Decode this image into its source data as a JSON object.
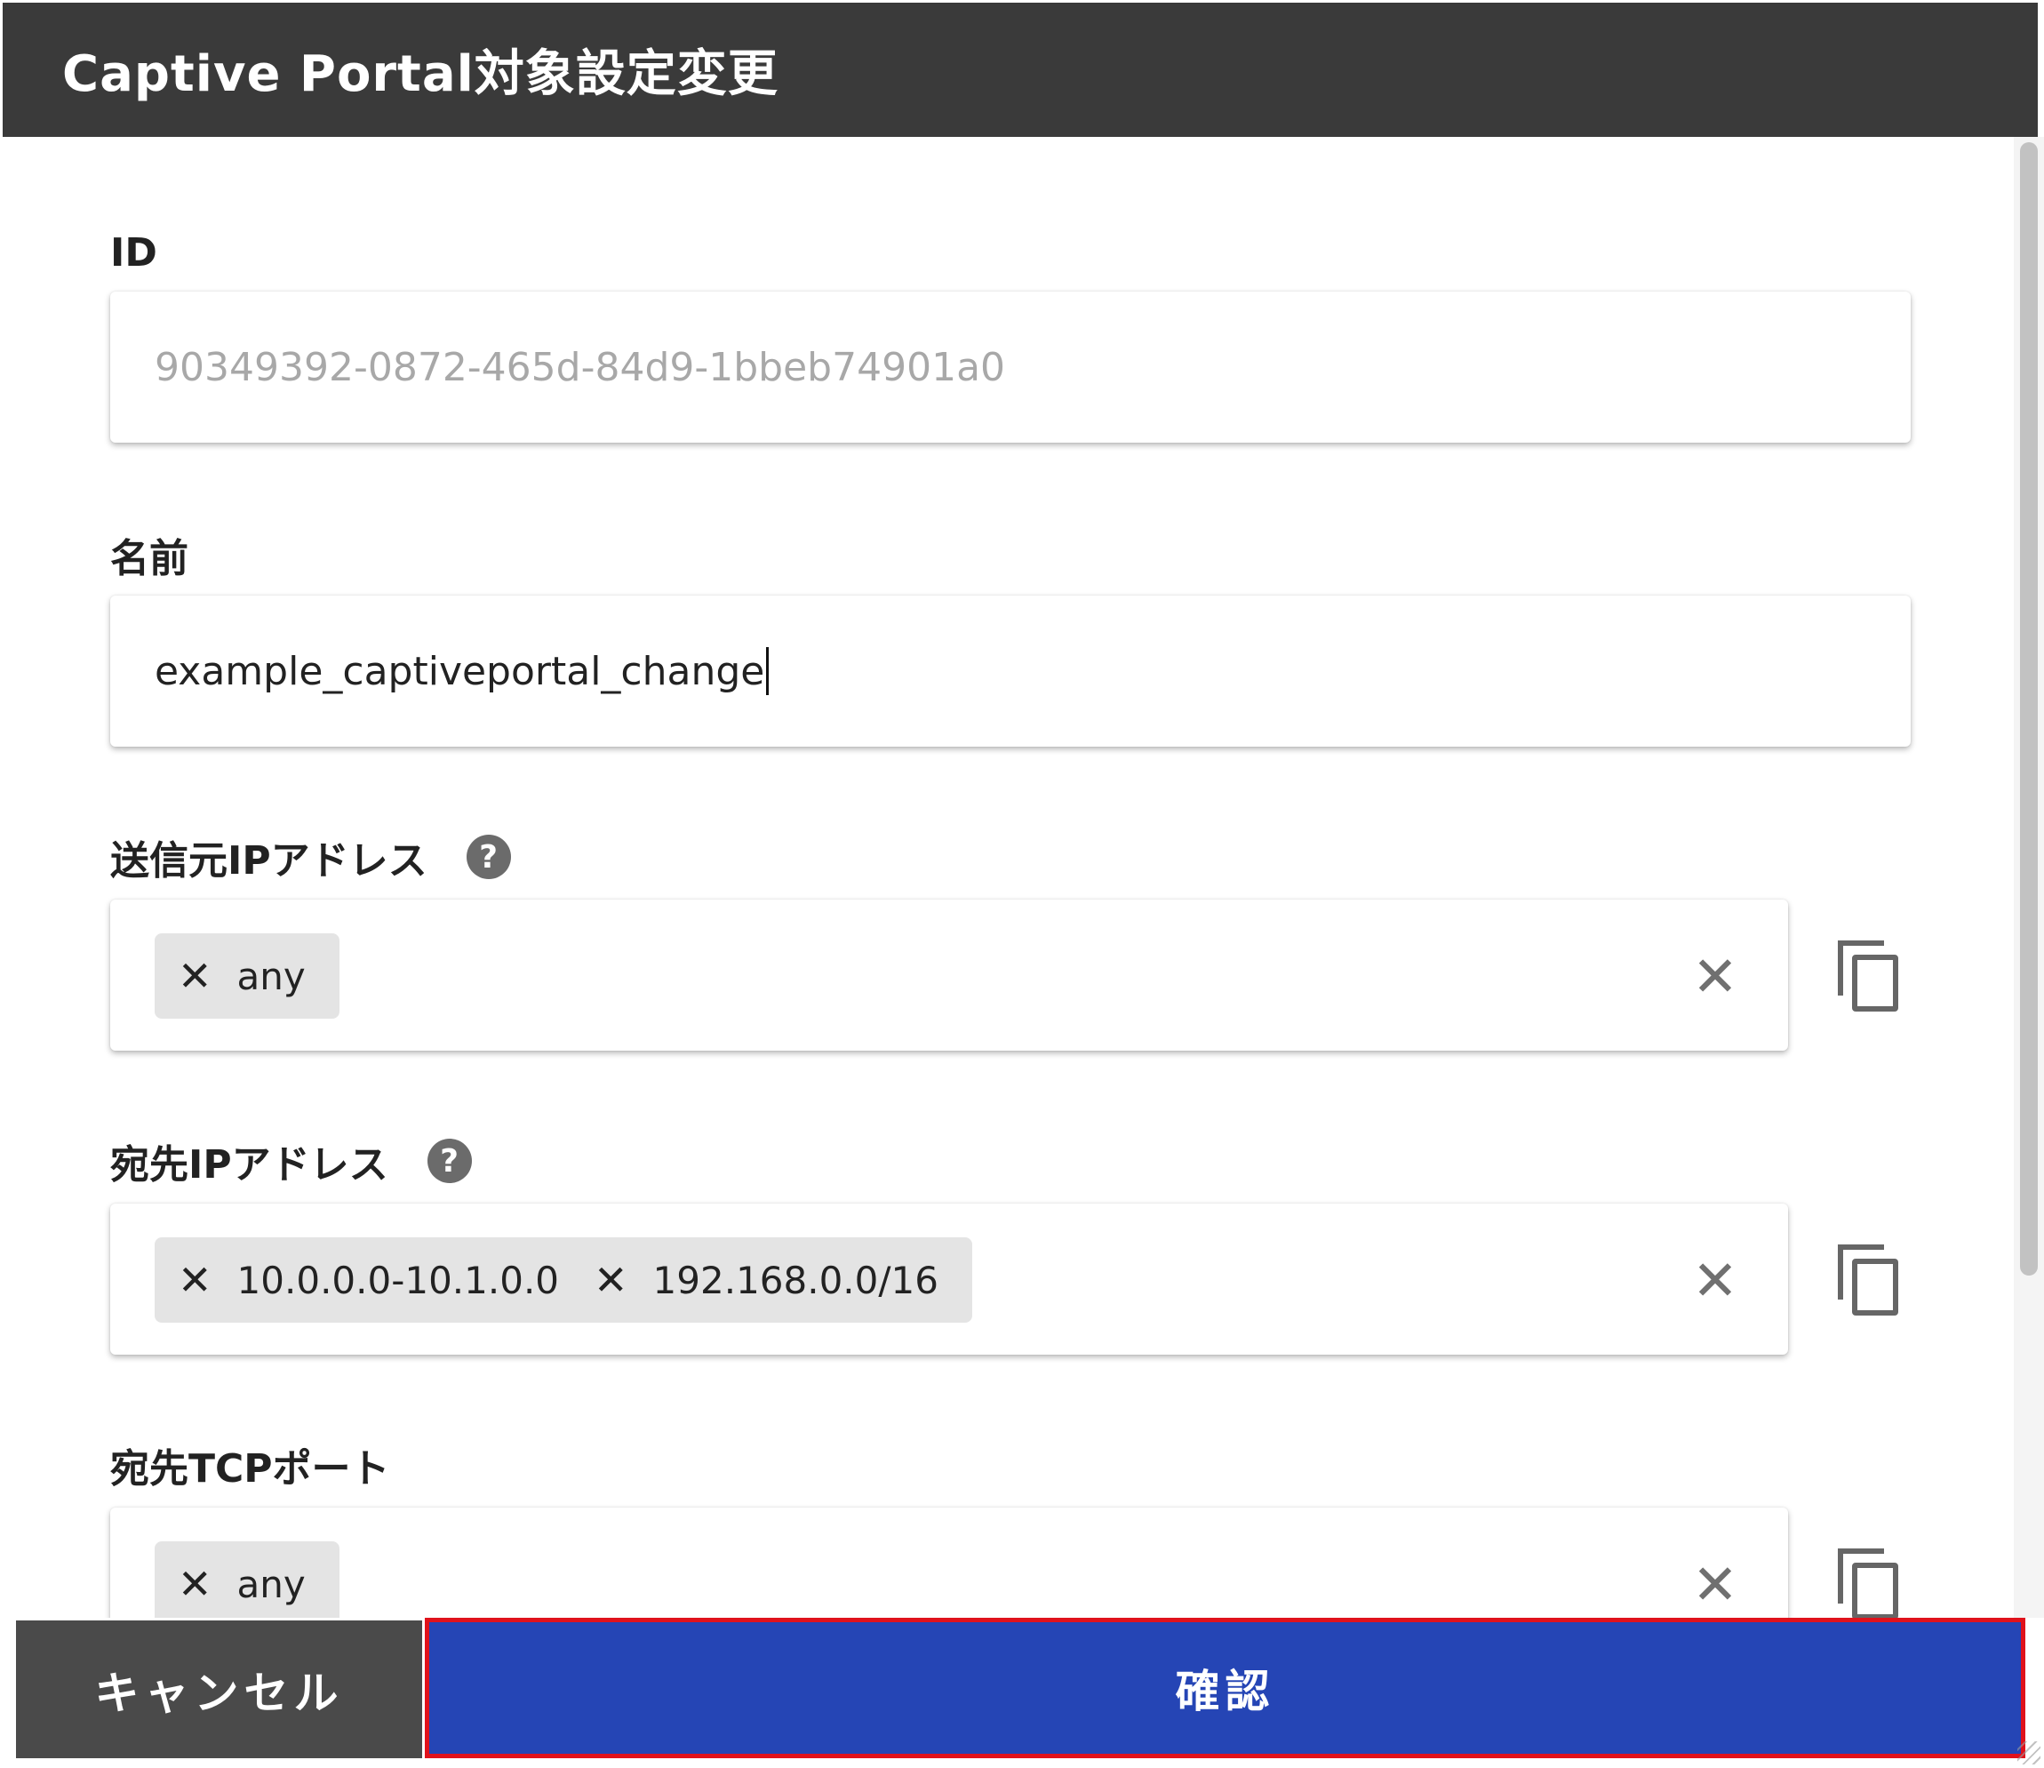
{
  "dialog": {
    "title": "Captive Portal対象設定変更"
  },
  "fields": {
    "id": {
      "label": "ID",
      "value": "90349392-0872-465d-84d9-1bbeb74901a0"
    },
    "name": {
      "label": "名前",
      "value": "example_captiveportal_change"
    },
    "source_ip": {
      "label": "送信元IPアドレス",
      "help_icon": "question-circle-icon",
      "chips": [
        "any"
      ],
      "clear_icon": "close-icon",
      "copy_icon": "copy-icon"
    },
    "dest_ip": {
      "label": "宛先IPアドレス",
      "help_icon": "question-circle-icon",
      "chips": [
        "10.0.0.0-10.1.0.0",
        "192.168.0.0/16"
      ],
      "clear_icon": "close-icon",
      "copy_icon": "copy-icon"
    },
    "dest_tcp_port": {
      "label": "宛先TCPポート",
      "chips": [
        "any"
      ],
      "clear_icon": "close-icon",
      "copy_icon": "copy-icon"
    }
  },
  "symbols": {
    "help": "?",
    "remove": "✕"
  },
  "footer": {
    "cancel_label": "キャンセル",
    "confirm_label": "確認"
  },
  "colors": {
    "titlebar": "#3a3a3a",
    "cancel_button": "#4a4a4a",
    "confirm_button": "#2545b5",
    "highlight_border": "#e0121c",
    "chip_background": "#e4e4e4"
  }
}
